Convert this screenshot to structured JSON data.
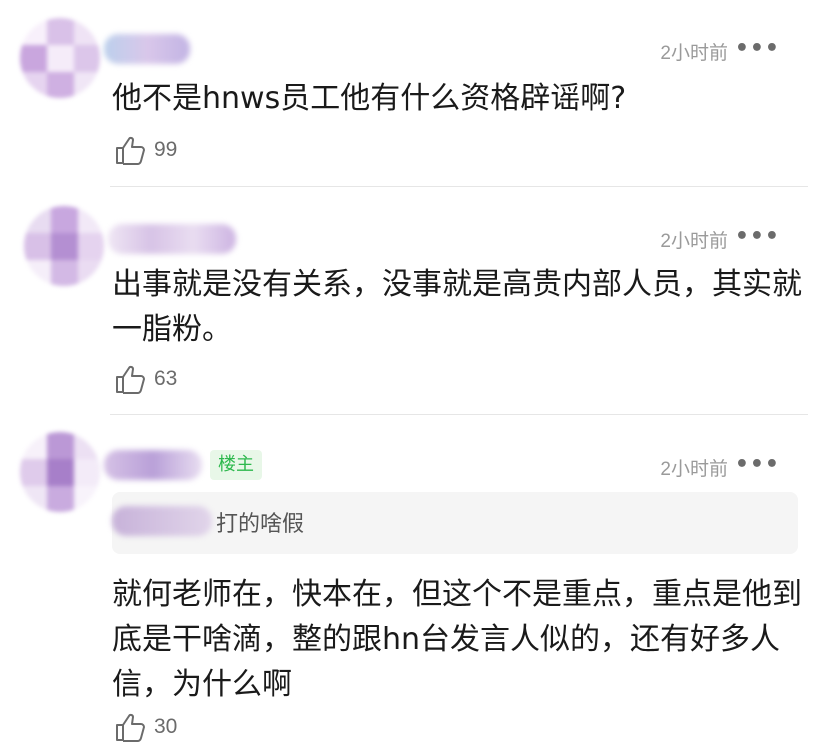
{
  "comments": [
    {
      "time": "2小时前",
      "more": "•••",
      "text": "他不是hnws员工他有什么资格辟谣啊?",
      "likes": "99"
    },
    {
      "time": "2小时前",
      "more": "•••",
      "text": "出事就是没有关系，没事就是高贵内部人员，其实就一脂粉。",
      "likes": "63"
    },
    {
      "time": "2小时前",
      "more": "•••",
      "badge": "楼主",
      "quote_text": "打的啥假",
      "text": "就何老师在，快本在，但这个不是重点，重点是他到底是干啥滴，整的跟hn台发言人似的，还有好多人信，为什么啊",
      "likes": "30"
    }
  ],
  "colors": {
    "badge_green": "#2db84d",
    "badge_bg": "#e8f7e8",
    "time_gray": "#9a9a9a",
    "divider": "#e6e6e6"
  },
  "icons": [
    "thumbs-up-icon",
    "more-options-icon"
  ]
}
